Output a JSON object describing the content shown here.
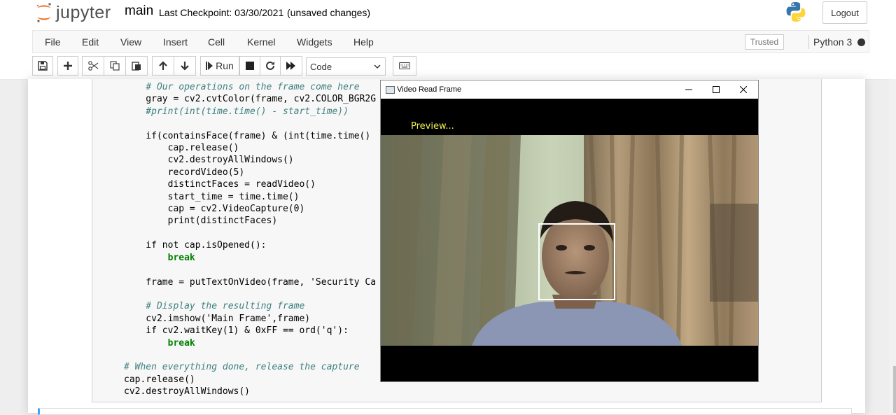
{
  "header": {
    "logo_text": "jupyter",
    "notebook_name": "main",
    "checkpoint": "Last Checkpoint: 03/30/2021",
    "unsaved": "(unsaved changes)",
    "logout_label": "Logout"
  },
  "menu": {
    "items": [
      "File",
      "Edit",
      "View",
      "Insert",
      "Cell",
      "Kernel",
      "Widgets",
      "Help"
    ],
    "trusted_label": "Trusted",
    "kernel_name": "Python 3"
  },
  "toolbar": {
    "run_label": "Run",
    "cell_type": "Code",
    "icons": [
      "save-icon",
      "plus-icon",
      "cut-icon",
      "copy-icon",
      "paste-icon",
      "arrow-up-icon",
      "arrow-down-icon",
      "step-forward-icon",
      "stop-icon",
      "restart-icon",
      "fast-forward-icon",
      "keyboard-icon"
    ]
  },
  "code_lines": [
    "    # Our operations on the frame come here",
    "    gray = cv2.cvtColor(frame, cv2.COLOR_BGR2G",
    "    #print(int(time.time() - start_time))",
    "",
    "    if(containsFace(frame) & (int(time.time()",
    "        cap.release()",
    "        cv2.destroyAllWindows()",
    "        recordVideo(5)",
    "        distinctFaces = readVideo()",
    "        start_time = time.time()",
    "        cap = cv2.VideoCapture(0)",
    "        print(distinctFaces)",
    "",
    "    if not cap.isOpened():",
    "        break",
    "",
    "    frame = putTextOnVideo(frame, 'Security Ca",
    "",
    "    # Display the resulting frame",
    "    cv2.imshow('Main Frame',frame)",
    "    if cv2.waitKey(1) & 0xFF == ord('q'):",
    "        break",
    "",
    "# When everything done, release the capture",
    "cap.release()",
    "cv2.destroyAllWindows()"
  ],
  "video_window": {
    "title": "Video Read Frame",
    "overlay_text": "Preview..."
  },
  "colors": {
    "keyword": "#008000",
    "comment": "#408080",
    "string": "#ba2121",
    "overlay_text": "#f2ee55",
    "active_cell": "#42a5f5"
  }
}
